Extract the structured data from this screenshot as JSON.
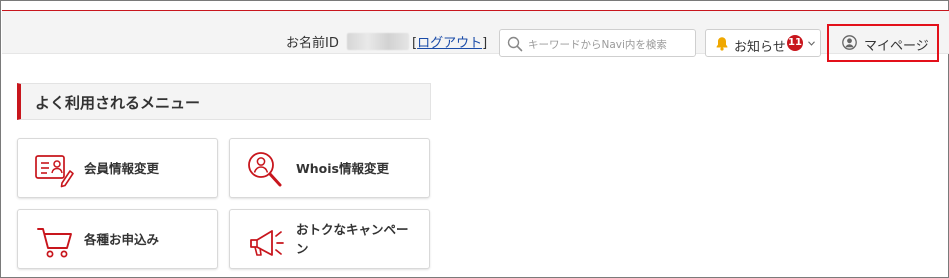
{
  "header": {
    "name_id_label": "お名前ID",
    "logout_open": "[",
    "logout_label": "ログアウト",
    "logout_close": "]",
    "search_placeholder": "キーワードからNavi内を検索",
    "notice_label": "お知らせ",
    "notice_count": "11",
    "mypage_label": "マイページ"
  },
  "section": {
    "title": "よく利用されるメニュー"
  },
  "menu": [
    {
      "label": "会員情報変更",
      "icon": "member-card-icon"
    },
    {
      "label": "Whois情報変更",
      "icon": "whois-search-icon"
    },
    {
      "label": "各種お申込み",
      "icon": "cart-icon"
    },
    {
      "label": "おトクなキャンペーン",
      "icon": "megaphone-icon"
    }
  ],
  "colors": {
    "accent": "#c8161d",
    "highlight": "#e3101a",
    "link": "#1a4ba8"
  }
}
